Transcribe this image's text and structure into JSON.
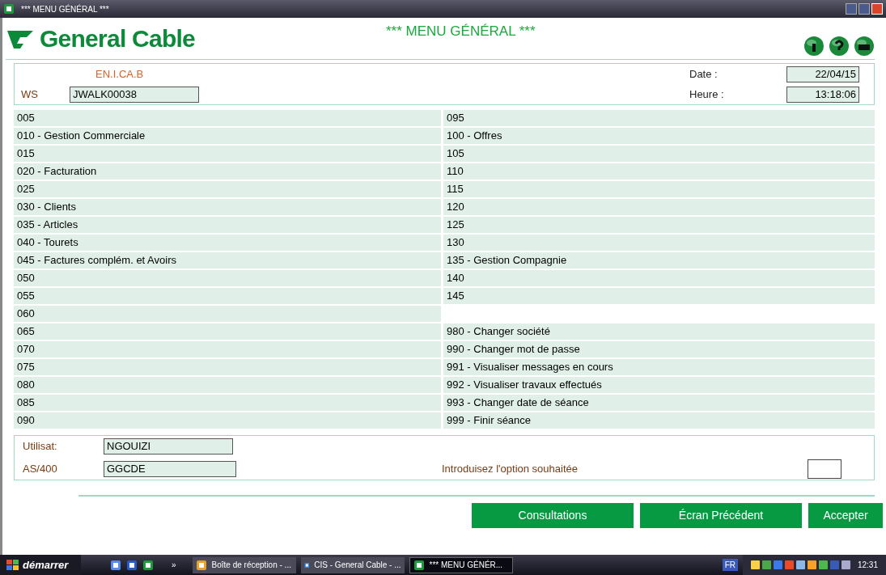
{
  "window": {
    "title": "*** MENU GÉNÉRAL ***"
  },
  "header": {
    "logo": "General Cable",
    "title": "*** MENU GÉNÉRAL ***"
  },
  "info": {
    "company": "EN.I.CA.B",
    "ws_label": "WS",
    "ws_value": "JWALK00038",
    "date_label": "Date :",
    "date_value": "22/04/15",
    "time_label": "Heure :",
    "time_value": "13:18:06"
  },
  "menu_left": [
    {
      "text": "005"
    },
    {
      "text": "010 - Gestion Commerciale"
    },
    {
      "text": "015"
    },
    {
      "text": "020 - Facturation"
    },
    {
      "text": "025"
    },
    {
      "text": "030 - Clients"
    },
    {
      "text": "035 - Articles"
    },
    {
      "text": "040 - Tourets"
    },
    {
      "text": "045 - Factures complém. et Avoirs"
    },
    {
      "text": "050"
    },
    {
      "text": "055"
    },
    {
      "text": "060"
    },
    {
      "text": "065"
    },
    {
      "text": "070"
    },
    {
      "text": "075"
    },
    {
      "text": "080"
    },
    {
      "text": "085"
    },
    {
      "text": "090"
    }
  ],
  "menu_right": [
    {
      "kind": "option",
      "text": "095"
    },
    {
      "kind": "option",
      "text": "100 - Offres"
    },
    {
      "kind": "option",
      "text": "105"
    },
    {
      "kind": "option",
      "text": "110"
    },
    {
      "kind": "option",
      "text": "115"
    },
    {
      "kind": "option",
      "text": "120"
    },
    {
      "kind": "option",
      "text": "125"
    },
    {
      "kind": "option",
      "text": "130"
    },
    {
      "kind": "option",
      "text": "135 - Gestion Compagnie"
    },
    {
      "kind": "option",
      "text": "140"
    },
    {
      "kind": "option",
      "text": "145"
    },
    {
      "kind": "blank"
    },
    {
      "kind": "option",
      "text": "980 - Changer société"
    },
    {
      "kind": "option",
      "text": "990 - Changer mot de passe"
    },
    {
      "kind": "option",
      "text": "991 - Visualiser messages en cours"
    },
    {
      "kind": "option",
      "text": "992 - Visualiser travaux effectués"
    },
    {
      "kind": "option",
      "text": "993 - Changer date de séance"
    },
    {
      "kind": "option",
      "text": "999 - Finir séance"
    }
  ],
  "footer": {
    "user_label": "Utilisat:",
    "user_value": "NGOUIZI",
    "system_label": "AS/400",
    "system_value": "GGCDE",
    "option_label": "Introduisez l'option souhaitée"
  },
  "buttons": [
    "Consultations",
    "Écran Précédent",
    "Accepter"
  ],
  "taskbar": {
    "start": "démarrer",
    "more": "»",
    "tasks": [
      {
        "label": "Boîte de réception - ...",
        "selected": false
      },
      {
        "label": "CIS - General Cable - ...",
        "selected": false
      },
      {
        "label": "*** MENU GÉNÉR...",
        "selected": true
      }
    ],
    "language": "FR",
    "clock": "12:31"
  }
}
